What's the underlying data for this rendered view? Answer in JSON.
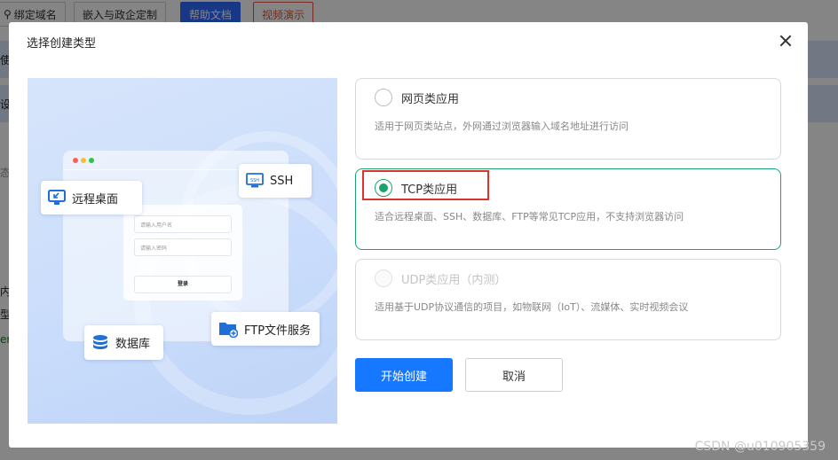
{
  "background": {
    "toolbar": [
      "绑定域名",
      "嵌入与政企定制",
      "帮助文档",
      "视频演示"
    ],
    "left_fragments": [
      "使",
      "设",
      "态",
      "内",
      "型",
      "er"
    ]
  },
  "dialog": {
    "title": "选择创建类型",
    "illustration": {
      "tags": {
        "remote_desktop": "远程桌面",
        "ssh": "SSH",
        "database": "数据库",
        "ftp": "FTP文件服务"
      },
      "login": {
        "username_placeholder": "请输入用户名",
        "password_placeholder": "请输入密码",
        "submit": "登录"
      }
    },
    "options": [
      {
        "title": "网页类应用",
        "desc": "适用于网页类站点，外网通过浏览器输入域名地址进行访问",
        "state": "unselected"
      },
      {
        "title": "TCP类应用",
        "desc": "适合远程桌面、SSH、数据库、FTP等常见TCP应用，不支持浏览器访问",
        "state": "selected"
      },
      {
        "title": "UDP类应用（内测）",
        "desc": "适用基于UDP协议通信的项目，如物联网（IoT）、流媒体、实时视频会议",
        "state": "disabled"
      }
    ],
    "buttons": {
      "create": "开始创建",
      "cancel": "取消"
    }
  },
  "watermark": "CSDN @u010905359",
  "colors": {
    "primary": "#1677ff",
    "selected": "#1aa36c",
    "highlight": "#e03131"
  }
}
